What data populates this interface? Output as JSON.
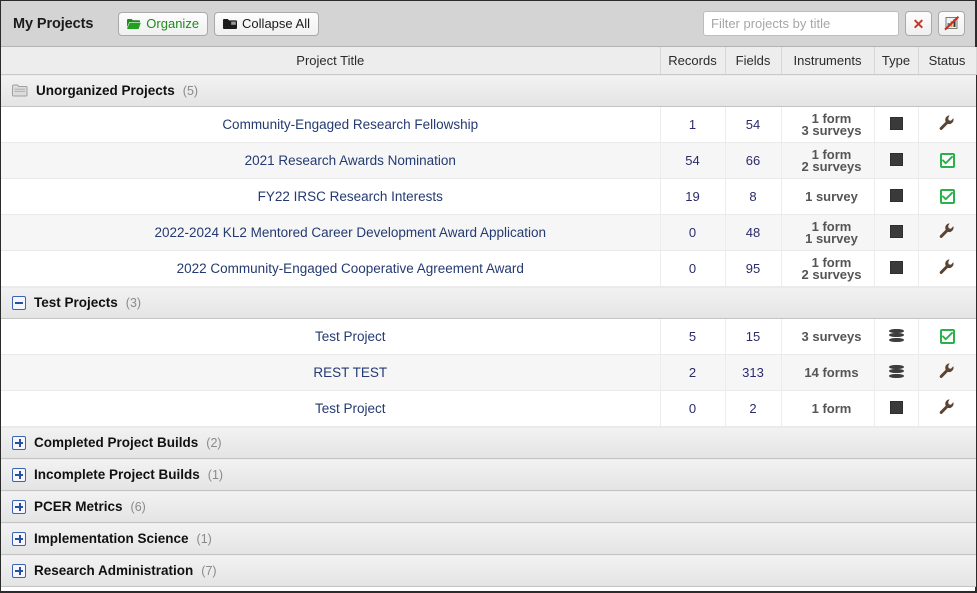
{
  "header": {
    "title": "My Projects",
    "organize_label": "Organize",
    "collapse_label": "Collapse All",
    "organize_icon": "open-folder-icon",
    "collapse_icon": "closed-folder-icon",
    "clear_filter_icon": "red-x-icon",
    "export_icon": "export-disabled-icon"
  },
  "filter": {
    "placeholder": "Filter projects by title",
    "value": ""
  },
  "columns": {
    "title": "Project Title",
    "records": "Records",
    "fields": "Fields",
    "instruments": "Instruments",
    "type": "Type",
    "status": "Status"
  },
  "colors": {
    "organize_green": "#1f8a1f",
    "link_blue": "#243a72",
    "status_green": "#2bb04b",
    "toggle_blue": "#2a4fa0",
    "titlebar_grey": "#d4d4d4"
  },
  "groups": [
    {
      "name": "Unorganized Projects",
      "count": "(5)",
      "icon": "grey-folder-icon",
      "expanded": true,
      "projects": [
        {
          "title": "Community-Engaged Research Fellowship",
          "records": "1",
          "fields": "54",
          "instruments": [
            "1 form",
            "3 surveys"
          ],
          "type_icon": "square-classic-icon",
          "status_icon": "wrench-development-icon"
        },
        {
          "title": "2021 Research Awards Nomination",
          "records": "54",
          "fields": "66",
          "instruments": [
            "1 form",
            "2 surveys"
          ],
          "type_icon": "square-classic-icon",
          "status_icon": "green-check-production-icon"
        },
        {
          "title": "FY22 IRSC Research Interests",
          "records": "19",
          "fields": "8",
          "instruments": [
            "1 survey"
          ],
          "type_icon": "square-classic-icon",
          "status_icon": "green-check-production-icon"
        },
        {
          "title": "2022-2024 KL2 Mentored Career Development Award Application",
          "records": "0",
          "fields": "48",
          "instruments": [
            "1 form",
            "1 survey"
          ],
          "type_icon": "square-classic-icon",
          "status_icon": "wrench-development-icon"
        },
        {
          "title": "2022 Community-Engaged Cooperative Agreement Award",
          "records": "0",
          "fields": "95",
          "instruments": [
            "1 form",
            "2 surveys"
          ],
          "type_icon": "square-classic-icon",
          "status_icon": "wrench-development-icon"
        }
      ]
    },
    {
      "name": "Test Projects",
      "count": "(3)",
      "icon": "minus-toggle-icon",
      "expanded": true,
      "projects": [
        {
          "title": "Test Project",
          "records": "5",
          "fields": "15",
          "instruments": [
            "3 surveys"
          ],
          "type_icon": "stack-longitudinal-icon",
          "status_icon": "green-check-production-icon"
        },
        {
          "title": "REST TEST",
          "records": "2",
          "fields": "313",
          "instruments": [
            "14 forms"
          ],
          "type_icon": "stack-longitudinal-icon",
          "status_icon": "wrench-development-icon"
        },
        {
          "title": "Test Project",
          "records": "0",
          "fields": "2",
          "instruments": [
            "1 form"
          ],
          "type_icon": "square-classic-icon",
          "status_icon": "wrench-development-icon"
        }
      ]
    },
    {
      "name": "Completed Project Builds",
      "count": "(2)",
      "icon": "plus-toggle-icon",
      "expanded": false,
      "projects": []
    },
    {
      "name": "Incomplete Project Builds",
      "count": "(1)",
      "icon": "plus-toggle-icon",
      "expanded": false,
      "projects": []
    },
    {
      "name": "PCER Metrics",
      "count": "(6)",
      "icon": "plus-toggle-icon",
      "expanded": false,
      "projects": []
    },
    {
      "name": "Implementation Science",
      "count": "(1)",
      "icon": "plus-toggle-icon",
      "expanded": false,
      "projects": []
    },
    {
      "name": "Research Administration",
      "count": "(7)",
      "icon": "plus-toggle-icon",
      "expanded": false,
      "projects": []
    }
  ]
}
